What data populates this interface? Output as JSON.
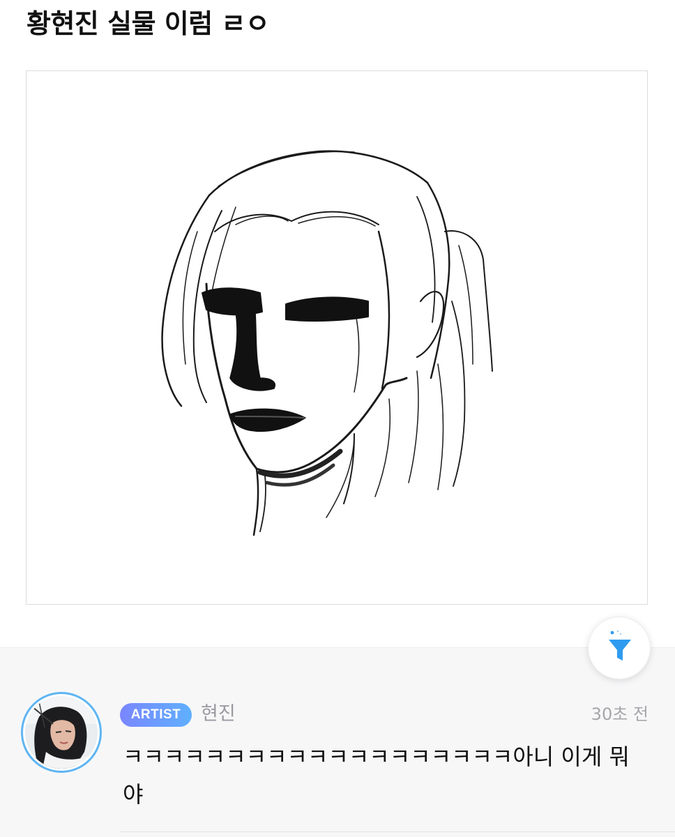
{
  "post": {
    "title": "황현진 실물 이럼 ㄹㅇ"
  },
  "comment": {
    "badge": "ARTIST",
    "author": "현진",
    "time": "30초 전",
    "text": "ㅋㅋㅋㅋㅋㅋㅋㅋㅋㅋㅋㅋㅋㅋㅋㅋㅋㅋㅋ아니 이게 뭐야"
  },
  "icons": {
    "filter": "filter-funnel-icon",
    "avatar": "avatar-photo"
  },
  "colors": {
    "accent": "#2e9bf0",
    "badge_start": "#7a86ff",
    "badge_end": "#5fb0ff",
    "avatar_ring": "#5fb5f2"
  }
}
